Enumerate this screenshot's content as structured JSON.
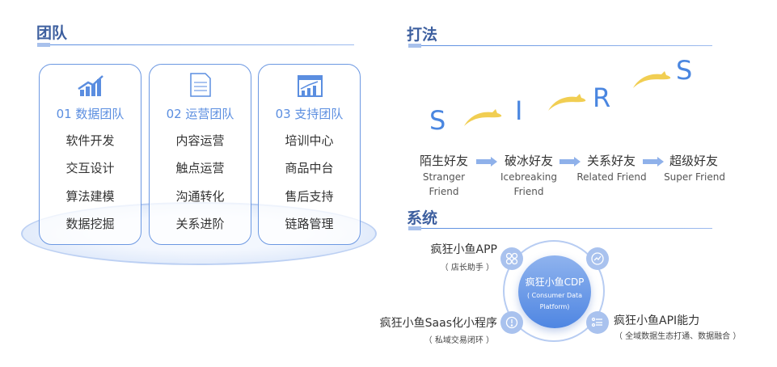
{
  "team": {
    "title": "团队",
    "cards": [
      {
        "icon": "bar-chart-growth-icon",
        "heading": "01 数据团队",
        "items": [
          "软件开发",
          "交互设计",
          "算法建模",
          "数据挖掘"
        ]
      },
      {
        "icon": "document-icon",
        "heading": "02 运营团队",
        "items": [
          "内容运营",
          "触点运营",
          "沟通转化",
          "关系进阶"
        ]
      },
      {
        "icon": "dashboard-window-icon",
        "heading": "03 支持团队",
        "items": [
          "培训中心",
          "商品中台",
          "售后支持",
          "链路管理"
        ]
      }
    ]
  },
  "strategy": {
    "title": "打法",
    "letters": [
      "S",
      "I",
      "R",
      "S"
    ],
    "stages": [
      {
        "cn": "陌生好友",
        "en": "Stranger Friend"
      },
      {
        "cn": "破冰好友",
        "en": "Icebreaking Friend"
      },
      {
        "cn": "关系好友",
        "en": "Related Friend"
      },
      {
        "cn": "超级好友",
        "en": "Super Friend"
      }
    ]
  },
  "system": {
    "title": "系统",
    "center": {
      "title": "疯狂小鱼CDP",
      "subtitle": "( Consumer Data Platform)"
    },
    "nodes": [
      {
        "label": "疯狂小鱼APP",
        "sub": "（ 店长助手 ）",
        "icon": "app-grid-icon"
      },
      {
        "label": "疯狂小鱼Saas化小程序",
        "sub": "（ 私域交易闭环 ）",
        "icon": "mini-program-icon"
      },
      {
        "label": "疯狂小鱼API能力",
        "sub": "（ 全域数据生态打通、数据融合 ）",
        "icon": "api-list-icon"
      },
      {
        "label": "",
        "sub": "",
        "icon": "trend-chart-icon"
      }
    ]
  },
  "colors": {
    "accent": "#5b8ee0",
    "title": "#3d5f9f",
    "fish": "#f0cc4a"
  }
}
